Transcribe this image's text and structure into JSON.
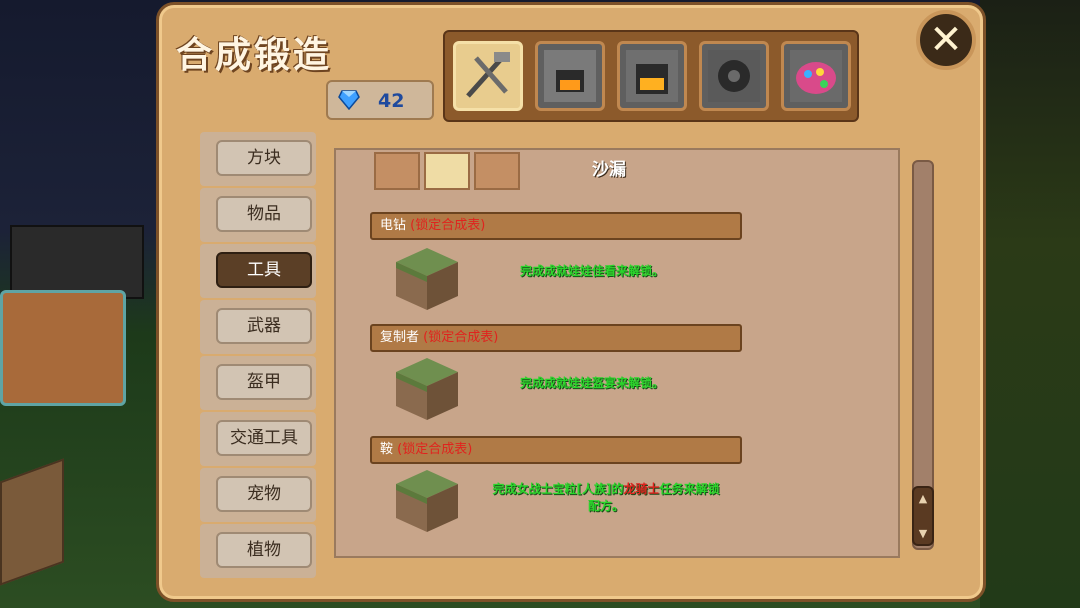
{
  "title": "合成锻造",
  "gems": {
    "count": "42"
  },
  "tabs": [
    {
      "name": "tools-tab",
      "active": true
    },
    {
      "name": "furnace-tab",
      "active": false
    },
    {
      "name": "forge-tab",
      "active": false
    },
    {
      "name": "gear-tab",
      "active": false
    },
    {
      "name": "paint-tab",
      "active": false
    }
  ],
  "categories": [
    "方块",
    "物品",
    "工具",
    "武器",
    "盔甲",
    "交通工具",
    "宠物",
    "植物"
  ],
  "active_category": "工具",
  "top_item": {
    "name": "沙漏"
  },
  "recipes": [
    {
      "name": "电钻",
      "locked_label": "(锁定合成表)",
      "desc": "完成成就娃娃佳看来解锁。"
    },
    {
      "name": "复制者",
      "locked_label": "(锁定合成表)",
      "desc": "完成成就娃娃盔宴来解锁。"
    },
    {
      "name": "鞍",
      "locked_label": "(锁定合成表)",
      "desc_part1": "完成女战士宝粒[人族]的",
      "desc_red": "龙骑士",
      "desc_part2": "任务来解锁",
      "desc_line2": "配方。"
    }
  ],
  "scroll": {
    "up": "▲",
    "down": "▼"
  },
  "close": {
    "label": "✕"
  }
}
